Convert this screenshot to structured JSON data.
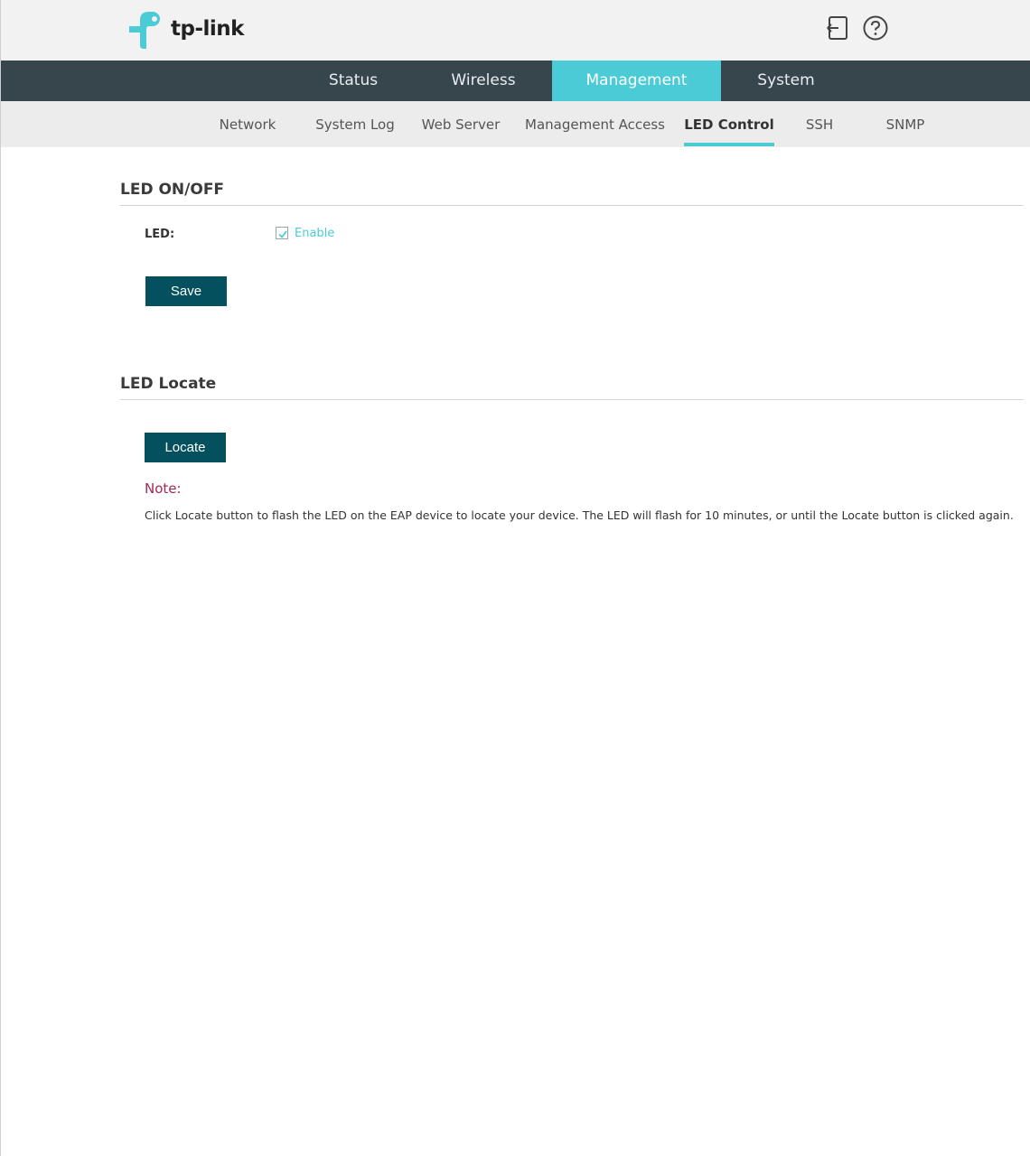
{
  "header": {
    "logo_text": "tp-link",
    "logout_icon": "logout-icon",
    "help_icon": "help-icon"
  },
  "main_nav": [
    {
      "label": "Status",
      "active": false
    },
    {
      "label": "Wireless",
      "active": false
    },
    {
      "label": "Management",
      "active": true
    },
    {
      "label": "System",
      "active": false
    }
  ],
  "sub_nav": [
    {
      "label": "Network",
      "active": false
    },
    {
      "label": "System Log",
      "active": false
    },
    {
      "label": "Web Server",
      "active": false
    },
    {
      "label": "Management Access",
      "active": false
    },
    {
      "label": "LED Control",
      "active": true
    },
    {
      "label": "SSH",
      "active": false
    },
    {
      "label": "SNMP",
      "active": false
    }
  ],
  "led_onoff": {
    "title": "LED ON/OFF",
    "field_label": "LED:",
    "checkbox_label": "Enable",
    "checked": true,
    "save_label": "Save"
  },
  "led_locate": {
    "title": "LED Locate",
    "locate_label": "Locate",
    "note_title": "Note:",
    "note_text": "Click Locate button to flash the LED on the EAP device to locate your device. The LED will flash for 10 minutes, or until the Locate button is clicked again."
  },
  "colors": {
    "accent": "#4acbd6",
    "nav_bg": "#37454d",
    "button_bg": "#04505f",
    "note_title": "#a3284f"
  }
}
